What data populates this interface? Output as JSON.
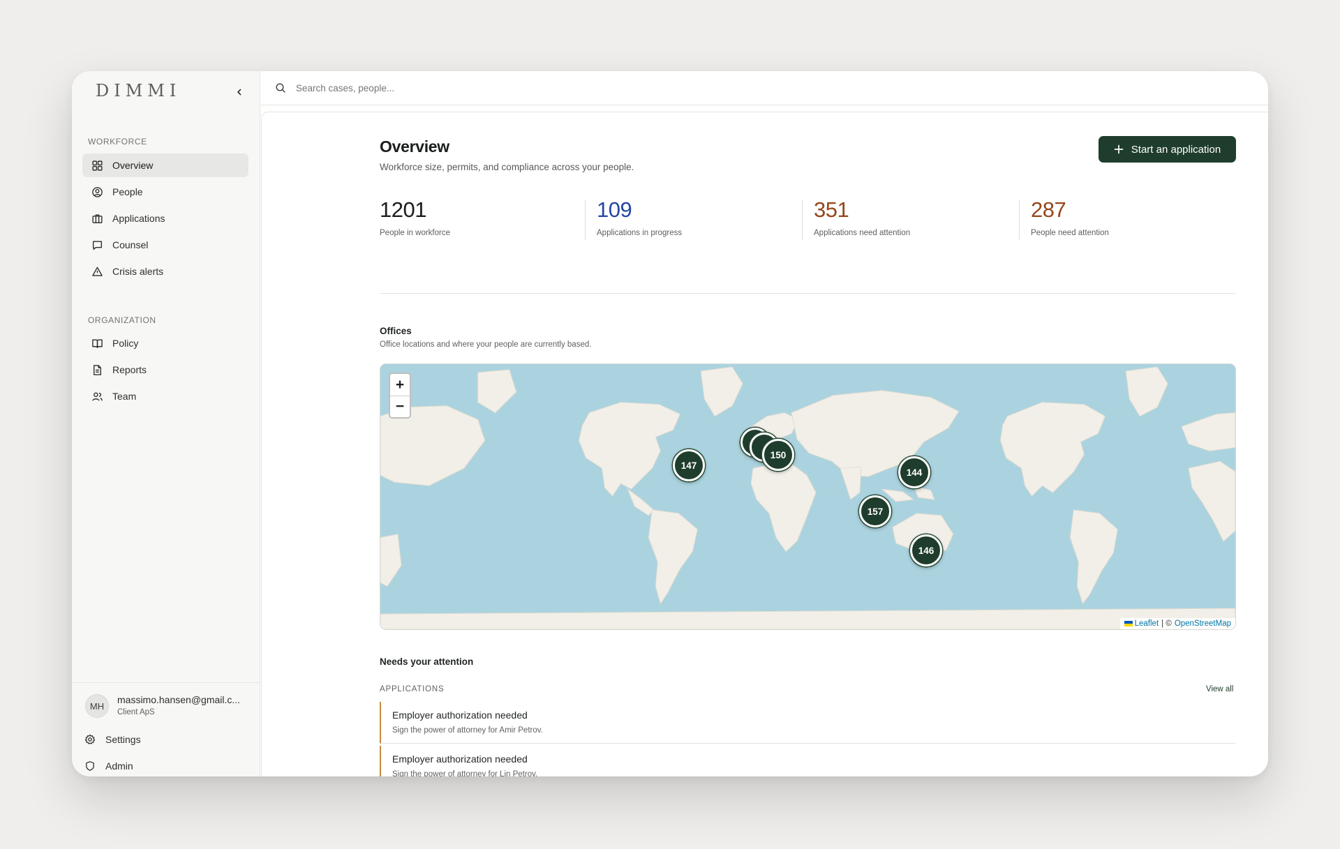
{
  "app": {
    "brand": "DIMMI"
  },
  "search": {
    "placeholder": "Search cases, people..."
  },
  "sidebar": {
    "workforce_label": "WORKFORCE",
    "workforce_items": [
      {
        "label": "Overview",
        "icon": "grid-icon",
        "active": true
      },
      {
        "label": "People",
        "icon": "user-circle-icon"
      },
      {
        "label": "Applications",
        "icon": "briefcase-icon"
      },
      {
        "label": "Counsel",
        "icon": "message-icon"
      },
      {
        "label": "Crisis alerts",
        "icon": "warning-icon"
      }
    ],
    "organization_label": "ORGANIZATION",
    "organization_items": [
      {
        "label": "Policy",
        "icon": "book-icon"
      },
      {
        "label": "Reports",
        "icon": "document-icon"
      },
      {
        "label": "Team",
        "icon": "users-icon"
      }
    ],
    "user": {
      "initials": "MH",
      "email": "massimo.hansen@gmail.c...",
      "org": "Client ApS"
    },
    "footer": {
      "settings": "Settings",
      "admin": "Admin"
    }
  },
  "overview": {
    "title": "Overview",
    "subtitle": "Workforce size, permits, and compliance across your people.",
    "cta": "Start an application",
    "stats": [
      {
        "value": "1201",
        "label": "People in workforce",
        "color": "#1a1d1b"
      },
      {
        "value": "109",
        "label": "Applications in progress",
        "color": "#2746a6"
      },
      {
        "value": "351",
        "label": "Applications need attention",
        "color": "#96461b"
      },
      {
        "value": "287",
        "label": "People need attention",
        "color": "#96461b"
      }
    ]
  },
  "offices": {
    "title": "Offices",
    "subtitle": "Office locations and where your people are currently based.",
    "zoom_in": "+",
    "zoom_out": "−",
    "clusters": [
      "147",
      "150",
      "144",
      "157",
      "146"
    ],
    "attribution": {
      "leaflet": "Leaflet",
      "separator": "| ©",
      "osm": "OpenStreetMap"
    }
  },
  "attention": {
    "title": "Needs your attention",
    "applications_label": "APPLICATIONS",
    "view_all": "View all",
    "items": [
      {
        "title": "Employer authorization needed",
        "desc": "Sign the power of attorney for Amir Petrov."
      },
      {
        "title": "Employer authorization needed",
        "desc": "Sign the power of attorney for Lin Petrov."
      }
    ]
  }
}
